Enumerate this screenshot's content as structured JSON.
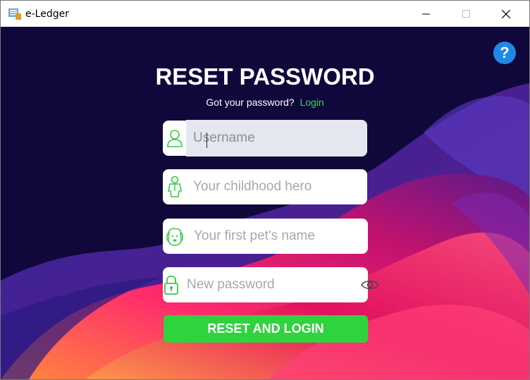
{
  "window": {
    "title": "e-Ledger"
  },
  "header": {
    "title": "RESET PASSWORD",
    "prompt": "Got your password?",
    "login_link": "Login"
  },
  "form": {
    "username": {
      "placeholder": "Username",
      "icon": "user-icon"
    },
    "hero": {
      "placeholder": "Your childhood hero",
      "icon": "hero-icon"
    },
    "pet": {
      "placeholder": "Your first pet's name",
      "icon": "dog-icon"
    },
    "new_password": {
      "placeholder": "New password",
      "icon": "lock-icon",
      "toggle_icon": "eye-icon"
    },
    "submit_label": "RESET AND LOGIN"
  },
  "help": {
    "label": "?"
  },
  "colors": {
    "accent": "#2fd33e",
    "link": "#39d353",
    "help": "#1e88e5",
    "background": "#10083a"
  }
}
